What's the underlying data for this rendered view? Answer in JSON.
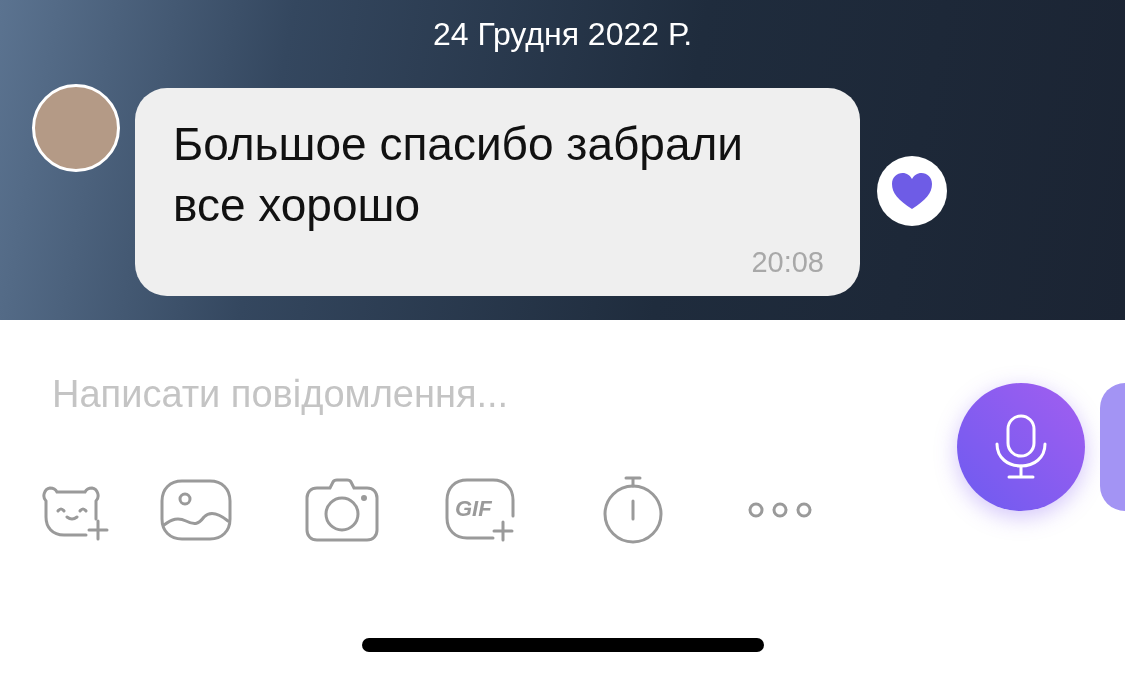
{
  "chat": {
    "date": "24 Грудня 2022 Р.",
    "messages": [
      {
        "text": "Большое спасибо забрали все хорошо",
        "time": "20:08",
        "reacted": true
      }
    ]
  },
  "composer": {
    "placeholder": "Написати повідомлення...",
    "gif_label": "GIF"
  }
}
